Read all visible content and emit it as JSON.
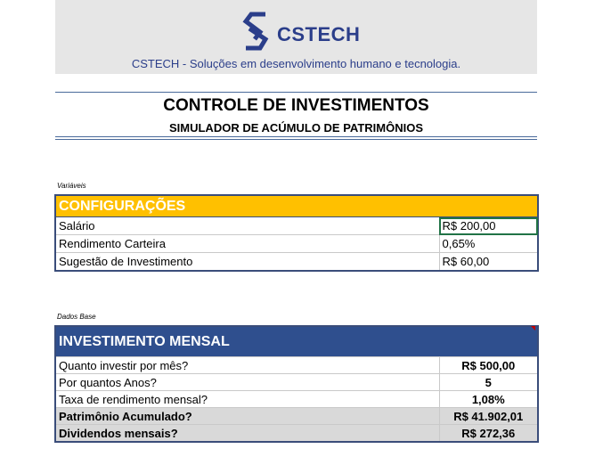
{
  "header": {
    "logo_text": "CSTECH",
    "tagline": "CSTECH - Soluções em desenvolvimento humano e tecnologia."
  },
  "title": "CONTROLE DE INVESTIMENTOS",
  "subtitle": "SIMULADOR DE ACÚMULO DE PATRIMÔNIOS",
  "config": {
    "section_label": "Variáveis",
    "header": "CONFIGURAÇÕES",
    "rows": [
      {
        "label": "Salário",
        "value": "R$ 200,00"
      },
      {
        "label": "Rendimento Carteira",
        "value": "0,65%"
      },
      {
        "label": "Sugestão de Investimento",
        "value": "R$ 60,00"
      }
    ]
  },
  "monthly": {
    "section_label": "Dados Base",
    "header": "INVESTIMENTO MENSAL",
    "rows": [
      {
        "label": "Quanto investir por mês?",
        "value": "R$ 500,00"
      },
      {
        "label": "Por quantos Anos?",
        "value": "5"
      },
      {
        "label": "Taxa de rendimento mensal?",
        "value": "1,08%"
      },
      {
        "label": "Patrimônio Acumulado?",
        "value": "R$ 41.902,01"
      },
      {
        "label": "Dividendos mensais?",
        "value": "R$ 272,36"
      }
    ]
  },
  "colors": {
    "brand": "#2b3e8a",
    "config_header": "#ffc000",
    "monthly_header": "#2f4f8e"
  }
}
